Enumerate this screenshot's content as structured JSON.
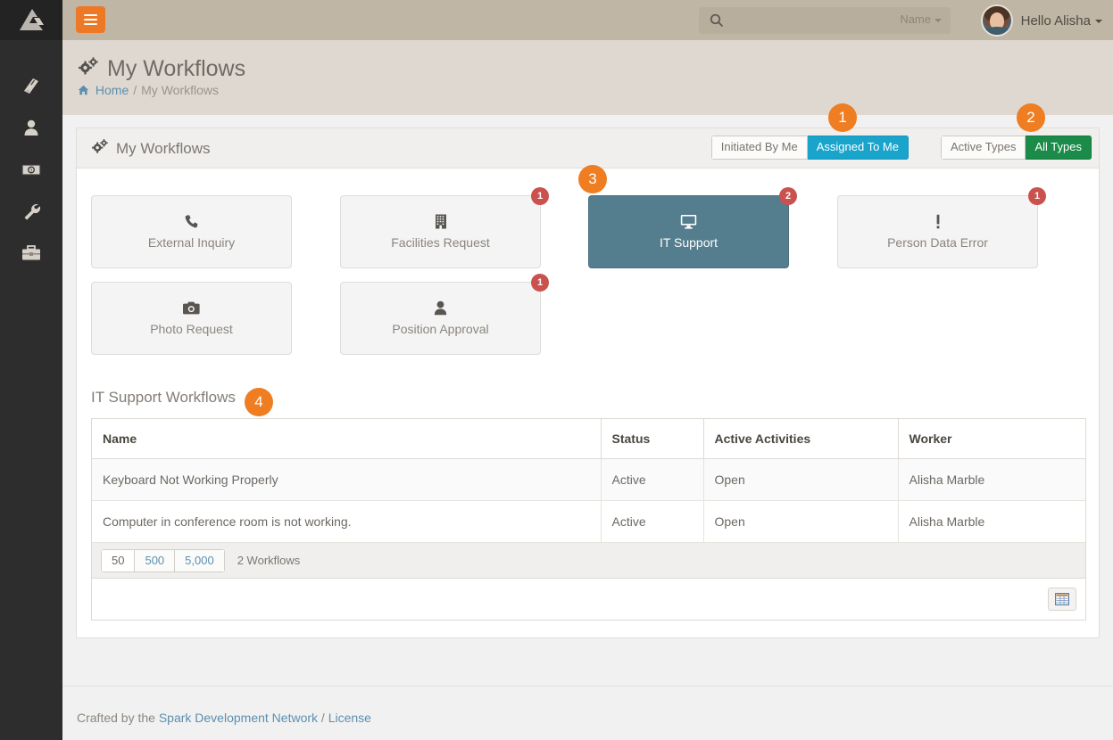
{
  "rail": {
    "logo_icon": "rock-rms-logo",
    "items": [
      {
        "name": "book-icon",
        "label": "CMS"
      },
      {
        "name": "person-icon",
        "label": "People"
      },
      {
        "name": "money-bill-icon",
        "label": "Finance"
      },
      {
        "name": "wrench-icon",
        "label": "Admin Tools"
      },
      {
        "name": "toolbox-icon",
        "label": "Tools"
      }
    ]
  },
  "topbar": {
    "menu_toggle_label": "",
    "search": {
      "value": "",
      "placeholder": "",
      "scope_label": "Name"
    },
    "user": {
      "greeting": "Hello Alisha"
    }
  },
  "pagehead": {
    "title": "My Workflows",
    "breadcrumb": {
      "home": "Home",
      "separator": "/",
      "current": "My Workflows"
    }
  },
  "panel": {
    "title": "My Workflows",
    "scope_toggle": {
      "options": [
        "Initiated By Me",
        "Assigned To Me"
      ],
      "selected": "Assigned To Me",
      "selected_color": "#19a4cc"
    },
    "types_toggle": {
      "options": [
        "Active Types",
        "All Types"
      ],
      "selected": "All Types",
      "selected_color": "#1b8b4a"
    }
  },
  "tiles": [
    {
      "label": "External Inquiry",
      "icon": "phone-icon",
      "count": null,
      "selected": false
    },
    {
      "label": "Facilities Request",
      "icon": "building-icon",
      "count": "1",
      "selected": false
    },
    {
      "label": "IT Support",
      "icon": "desktop-icon",
      "count": "2",
      "selected": true
    },
    {
      "label": "Person Data Error",
      "icon": "exclamation-icon",
      "count": "1",
      "selected": false
    },
    {
      "label": "Photo Request",
      "icon": "camera-icon",
      "count": null,
      "selected": false
    },
    {
      "label": "Position Approval",
      "icon": "user-icon",
      "count": "1",
      "selected": false
    }
  ],
  "list": {
    "title": "IT Support Workflows",
    "columns": [
      "Name",
      "Status",
      "Active Activities",
      "Worker"
    ],
    "rows": [
      {
        "name": "Keyboard Not Working Properly",
        "status": "Active",
        "activities": "Open",
        "worker": "Alisha Marble"
      },
      {
        "name": "Computer in conference room is not working.",
        "status": "Active",
        "activities": "Open",
        "worker": "Alisha Marble"
      }
    ],
    "page_sizes": [
      "50",
      "500",
      "5,000"
    ],
    "page_size_selected": "50",
    "row_count": "2 Workflows",
    "export_icon": "excel-grid-icon"
  },
  "markers": [
    {
      "id": "1",
      "label": "1"
    },
    {
      "id": "2",
      "label": "2"
    },
    {
      "id": "3",
      "label": "3"
    },
    {
      "id": "4",
      "label": "4"
    }
  ],
  "footer": {
    "prefix": "Crafted by the ",
    "link1": "Spark Development Network",
    "sep": " / ",
    "link2": "License"
  },
  "colors": {
    "topbar": "#c0b6a5",
    "pagehead": "#ded8d0",
    "accent_orange": "#ed7926",
    "selected_tile": "#547d8d",
    "badge_red": "#c9524f",
    "link_blue": "#5b8fb0"
  }
}
